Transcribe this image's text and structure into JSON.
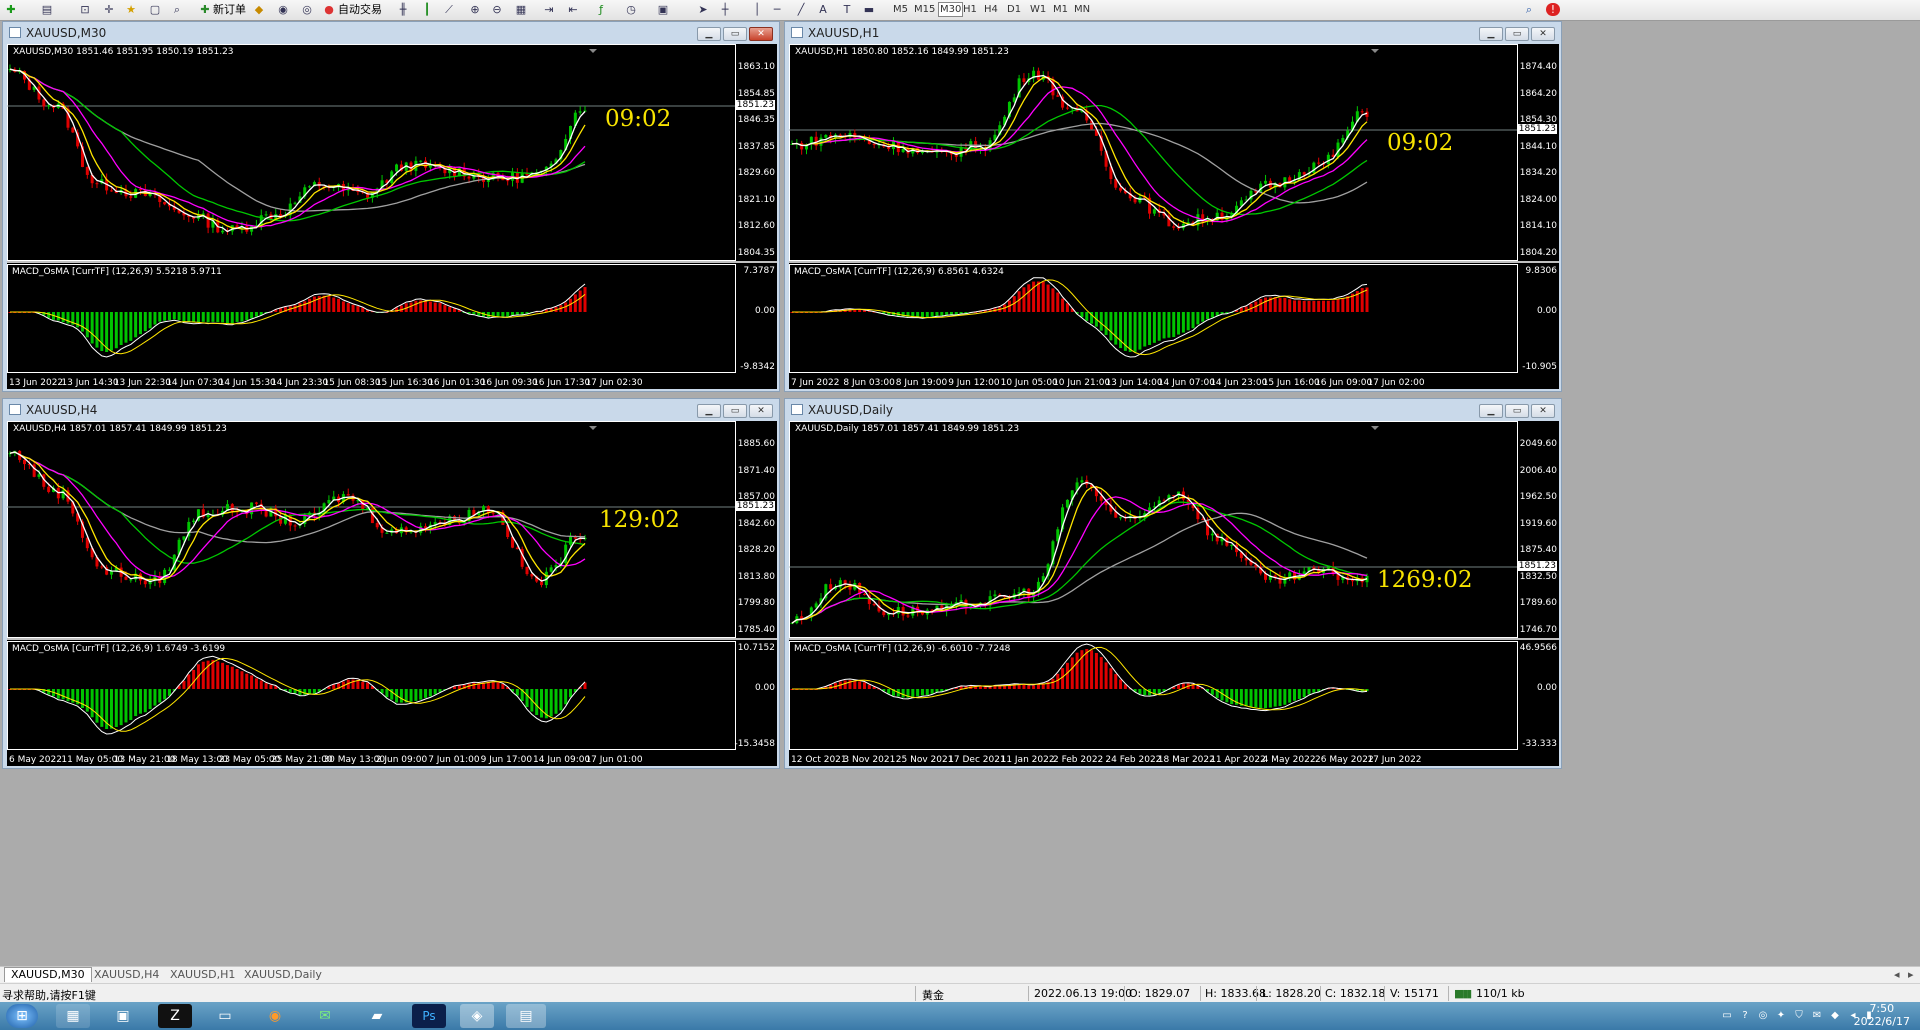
{
  "toolbar": {
    "new_order": "新订单",
    "auto_trading": "自动交易",
    "timeframes": [
      "M5",
      "M15",
      "M30",
      "H1",
      "H4",
      "D1",
      "W1",
      "M1",
      "MN"
    ]
  },
  "windows": [
    {
      "title": "XAUUSD,M30",
      "ohlc": "XAUUSD,M30  1851.46 1851.95 1850.19 1851.23",
      "timer": "09:02",
      "current_price": "1851.23",
      "price_labels": [
        "1863.10",
        "1854.85",
        "1846.35",
        "1837.85",
        "1829.60",
        "1821.10",
        "1812.60",
        "1804.35"
      ],
      "indicator": "MACD_OsMA [CurrTF] (12,26,9) 5.5218 5.9711",
      "ind_labels": [
        "7.3787",
        "0.00",
        "-9.8342"
      ],
      "time_labels": [
        "13 Jun 2022",
        "13 Jun 14:30",
        "13 Jun 22:30",
        "14 Jun 07:30",
        "14 Jun 15:30",
        "14 Jun 23:30",
        "15 Jun 08:30",
        "15 Jun 16:30",
        "16 Jun 01:30",
        "16 Jun 09:30",
        "16 Jun 17:30",
        "17 Jun 02:30"
      ]
    },
    {
      "title": "XAUUSD,H1",
      "ohlc": "XAUUSD,H1  1850.80 1852.16 1849.99 1851.23",
      "timer": "09:02",
      "current_price": "1851.23",
      "price_labels": [
        "1874.40",
        "1864.20",
        "1854.30",
        "1844.10",
        "1834.20",
        "1824.00",
        "1814.10",
        "1804.20"
      ],
      "indicator": "MACD_OsMA [CurrTF] (12,26,9) 6.8561 4.6324",
      "ind_labels": [
        "9.8306",
        "0.00",
        "-10.905"
      ],
      "time_labels": [
        "7 Jun 2022",
        "8 Jun 03:00",
        "8 Jun 19:00",
        "9 Jun 12:00",
        "10 Jun 05:00",
        "10 Jun 21:00",
        "13 Jun 14:00",
        "14 Jun 07:00",
        "14 Jun 23:00",
        "15 Jun 16:00",
        "16 Jun 09:00",
        "17 Jun 02:00"
      ]
    },
    {
      "title": "XAUUSD,H4",
      "ohlc": "XAUUSD,H4  1857.01 1857.41 1849.99 1851.23",
      "timer": "129:02",
      "current_price": "1851.23",
      "price_labels": [
        "1885.60",
        "1871.40",
        "1857.00",
        "1842.60",
        "1828.20",
        "1813.80",
        "1799.80",
        "1785.40"
      ],
      "indicator": "MACD_OsMA [CurrTF] (12,26,9) 1.6749 -3.6199",
      "ind_labels": [
        "10.7152",
        "0.00",
        "-15.3458"
      ],
      "time_labels": [
        "6 May 2022",
        "11 May 05:00",
        "13 May 21:00",
        "18 May 13:00",
        "23 May 05:00",
        "25 May 21:00",
        "30 May 13:00",
        "2 Jun 09:00",
        "7 Jun 01:00",
        "9 Jun 17:00",
        "14 Jun 09:00",
        "17 Jun 01:00"
      ]
    },
    {
      "title": "XAUUSD,Daily",
      "ohlc": "XAUUSD,Daily  1857.01 1857.41 1849.99 1851.23",
      "timer": "1269:02",
      "current_price": "1851.23",
      "price_labels": [
        "2049.60",
        "2006.40",
        "1962.50",
        "1919.60",
        "1875.40",
        "1832.50",
        "1789.60",
        "1746.70"
      ],
      "indicator": "MACD_OsMA [CurrTF] (12,26,9) -6.6010 -7.7248",
      "ind_labels": [
        "46.9566",
        "0.00",
        "-33.333"
      ],
      "time_labels": [
        "12 Oct 2021",
        "3 Nov 2021",
        "25 Nov 2021",
        "17 Dec 2021",
        "11 Jan 2022",
        "2 Feb 2022",
        "24 Feb 2022",
        "18 Mar 2022",
        "11 Apr 2022",
        "4 May 2022",
        "26 May 2022",
        "17 Jun 2022"
      ]
    }
  ],
  "tabs": [
    "XAUUSD,M30",
    "XAUUSD,H4",
    "XAUUSD,H1",
    "XAUUSD,Daily"
  ],
  "status": {
    "help": "寻求帮助,请按F1键",
    "profile": "黄金",
    "datetime": "2022.06.13 19:00",
    "open": "O: 1829.07",
    "high": "H: 1833.68",
    "low": "L: 1828.20",
    "close": "C: 1832.18",
    "volume": "V: 15171",
    "traffic": "110/1 kb"
  },
  "taskbar": {
    "time": "7:50",
    "date": "2022/6/17"
  },
  "colors": {
    "chart_bg": "#000000",
    "bull": "#00c400",
    "bear": "#e00000",
    "ma_white": "#ffffff",
    "ma_yellow": "#ffe600",
    "ma_magenta": "#ff00ff",
    "ma_green": "#00c800",
    "ma_gray": "#a0a0a0",
    "timer": "#f7e300"
  }
}
